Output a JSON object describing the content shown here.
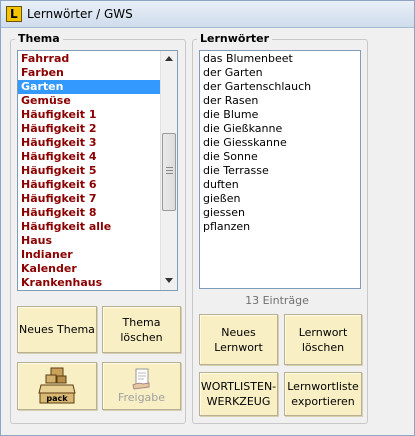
{
  "window": {
    "title": "Lernwörter / GWS"
  },
  "thema": {
    "group_title": "Thema",
    "items": [
      "Fahrrad",
      "Farben",
      "Garten",
      "Gemüse",
      "Häufigkeit 1",
      "Häufigkeit 2",
      "Häufigkeit 3",
      "Häufigkeit 4",
      "Häufigkeit 5",
      "Häufigkeit 6",
      "Häufigkeit 7",
      "Häufigkeit 8",
      "Häufigkeit alle",
      "Haus",
      "Indianer",
      "Kalender",
      "Krankenhaus"
    ],
    "selected": "Garten",
    "buttons": {
      "new": "Neues Thema",
      "delete_line1": "Thema",
      "delete_line2": "löschen",
      "pack_label": "pack",
      "release": "Freigabe"
    }
  },
  "lernwoerter": {
    "group_title": "Lernwörter",
    "items": [
      "das Blumenbeet",
      "der Garten",
      "der Gartenschlauch",
      "der Rasen",
      "die Blume",
      "die Gießkanne",
      "die Giesskanne",
      "die Sonne",
      "die Terrasse",
      "duften",
      "gießen",
      "giessen",
      "pflanzen"
    ],
    "count": "13 Einträge",
    "buttons": {
      "new_line1": "Neues",
      "new_line2": "Lernwort",
      "delete_line1": "Lernwort",
      "delete_line2": "löschen",
      "tools_line1": "WORTLISTEN-",
      "tools_line2": "WERKZEUG",
      "export_line1": "Lernwortliste",
      "export_line2": "exportieren"
    }
  },
  "colors": {
    "thema_text": "#8b0000",
    "selection": "#3399ff",
    "button_bg": "#f8f0c4"
  }
}
